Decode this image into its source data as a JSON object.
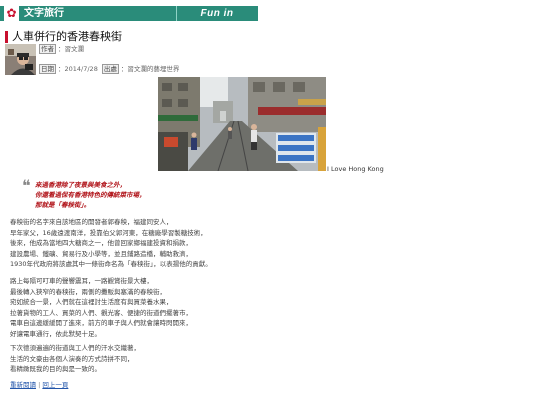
{
  "header": {
    "logo_glyph": "✿",
    "title": "文字旅行",
    "english_title": "Fun in HongKong"
  },
  "article": {
    "title": "人車併行的香港春秧街",
    "author_label": "作者",
    "author": "：習文瀾",
    "date_label": "日期",
    "date": "：2014/7/28",
    "source_label": "出處",
    "source": "：習文瀾的藝埋世界",
    "photo_caption": "I Love Hong Kong",
    "quote": [
      "來過香港除了夜景與美食之外，",
      "你還看過保有香港特色的傳統菜市場，",
      "那就是「春秧街」。"
    ],
    "paragraphs": [
      [
        "春秧街的名字來自該地區的開發者郭春秧，福建同安人，",
        "早年家父，16歲遠渡南洋，投靠伯父郭河東，在糖廠學習製糖技術，",
        "後來，他成為當地四大糖商之一，他曾回家鄉福建投資和捐款，",
        "建設農場、鐵礦、貿易行及小學等，並且鋪路造橋，輔助救濟，",
        "1930年代政府將該處其中一條街命名為「春秧街」，以表揚他的貢獻。"
      ],
      [
        "路上每隔可叮車的聲響震耳，一路觀賞街景大樓，",
        "最後轉入狹窄的春秧街，兩側的攤販與塞滿的春秧街，",
        "宛如統合一景，人們就在這裡討生活度有與買菜養水果，",
        "拉著貨物的工人、買菜的人們、觀光客、便捷的街道們擺著市，",
        "電車自這邊緩緩開了進來，前方的車子與人們就會讓時閃開來，",
        "好讓電車通行，依此默契十足。"
      ],
      [
        "下次德須遍遍的街道與工人們的汗水交織著，",
        "生活的文豪由各個人演奏的方式詩拼不同，",
        "看精緻既我的目的與是一致的。"
      ]
    ],
    "links": {
      "read_again": "重新閱讀",
      "separator": "|",
      "back_top": "回上一頁"
    }
  },
  "colors": {
    "banner": "#2a8c7a",
    "accent": "#c8102e",
    "quote": "#b01218",
    "link": "#2255aa"
  }
}
